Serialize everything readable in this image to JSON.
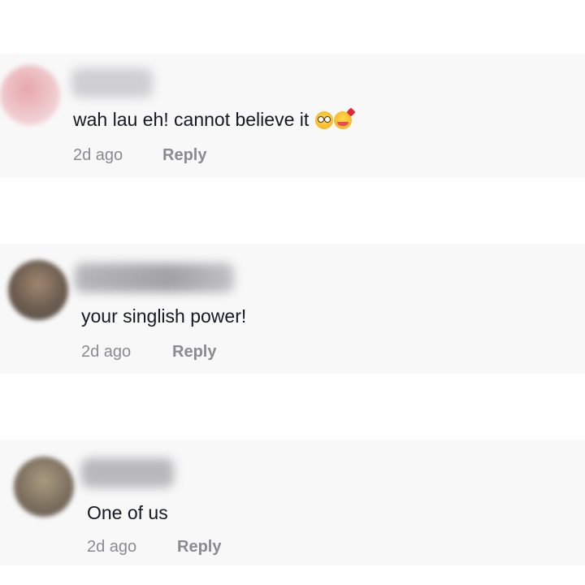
{
  "comments": [
    {
      "text": "wah lau eh! cannot believe it",
      "emoji": [
        "flushed-face-icon",
        "smiling-face-with-hearts-icon"
      ],
      "time": "2d ago",
      "reply_label": "Reply",
      "avatar_color": "#e8b9bd",
      "name_blur_color": "#c9c9cc"
    },
    {
      "text": "your singlish power!",
      "emoji": [],
      "time": "2d ago",
      "reply_label": "Reply",
      "avatar_color": "#7a6a5c",
      "name_blur_color": "#a9a9ad"
    },
    {
      "text": "One of us",
      "emoji": [],
      "time": "2d ago",
      "reply_label": "Reply",
      "avatar_color": "#8c7e6c",
      "name_blur_color": "#b5b5ba"
    }
  ],
  "colors": {
    "card_background": "#f8f8f8",
    "page_background": "#ffffff",
    "text_primary": "#161823",
    "text_secondary": "#8a8b91"
  }
}
